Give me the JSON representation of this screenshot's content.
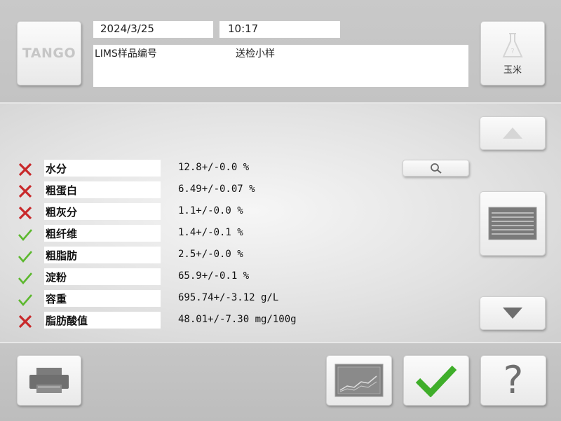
{
  "header": {
    "logo_text": "TANGO",
    "date": "2024/3/25",
    "time": "10:17",
    "lims_label": "LIMS样品编号",
    "sample_label": "送检小样",
    "product_label": "玉米"
  },
  "results": [
    {
      "name": "水分",
      "value": "12.8+/-0.0 %",
      "status": "fail"
    },
    {
      "name": "粗蛋白",
      "value": "6.49+/-0.07 %",
      "status": "fail"
    },
    {
      "name": "粗灰分",
      "value": "1.1+/-0.0 %",
      "status": "fail"
    },
    {
      "name": "粗纤维",
      "value": "1.4+/-0.1 %",
      "status": "pass"
    },
    {
      "name": "粗脂肪",
      "value": "2.5+/-0.0 %",
      "status": "pass"
    },
    {
      "name": "淀粉",
      "value": "65.9+/-0.1 %",
      "status": "pass"
    },
    {
      "name": "容重",
      "value": "695.74+/-3.12 g/L",
      "status": "pass"
    },
    {
      "name": "脂肪酸值",
      "value": "48.01+/-7.30 mg/100g",
      "status": "fail"
    }
  ],
  "colors": {
    "fail": "#c8282a",
    "pass": "#5cb82e",
    "ok_check": "#3fae2a"
  },
  "icons": {
    "fail": "x-mark-icon",
    "pass": "check-mark-icon",
    "search": "magnifier-icon",
    "product": "flask-icon",
    "print": "printer-icon",
    "chart": "chart-icon",
    "list": "list-icon",
    "up": "triangle-up-icon",
    "down": "triangle-down-icon",
    "ok": "check-icon",
    "help": "question-icon"
  },
  "footer": {
    "help_label": "?"
  }
}
